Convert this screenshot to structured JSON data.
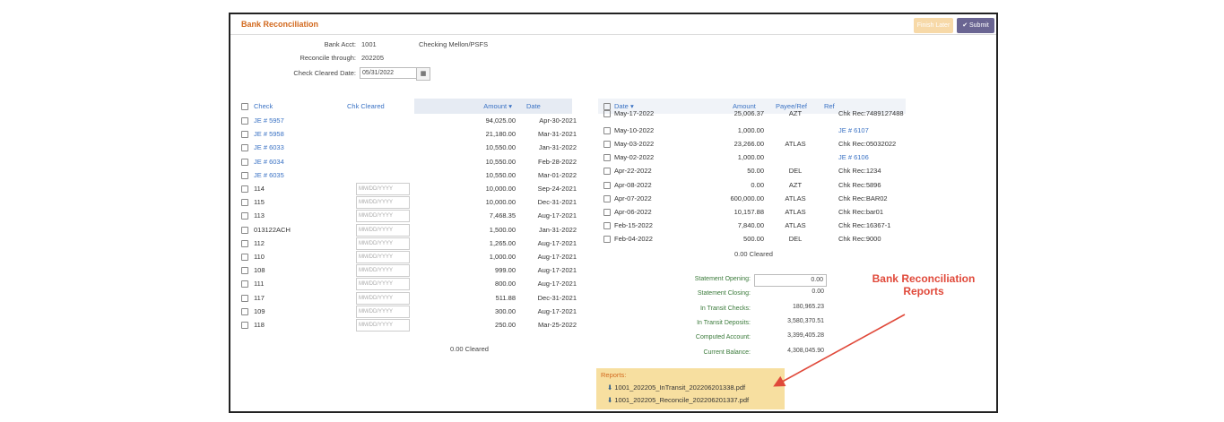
{
  "header": {
    "title": "Bank Reconciliation",
    "finish_later": "Finish Later",
    "submit": "Submit"
  },
  "form": {
    "bank_acct_label": "Bank Acct:",
    "bank_acct_value": "1001",
    "bank_acct_name": "Checking Mellon/PSFS",
    "reconcile_label": "Reconcile through:",
    "reconcile_value": "202205",
    "cleared_label": "Check Cleared Date:",
    "cleared_value": "05/31/2022"
  },
  "left_table": {
    "headers": {
      "check": "Check",
      "chk_cleared": "Chk Cleared",
      "amount": "Amount",
      "date": "Date"
    },
    "placeholder": "MM/DD/YYYY",
    "rows": [
      {
        "check": "JE # 5957",
        "amount": "94,025.00",
        "date": "Apr-30-2021",
        "link": true
      },
      {
        "check": "JE # 5958",
        "amount": "21,180.00",
        "date": "Mar-31-2021",
        "link": true
      },
      {
        "check": "JE # 6033",
        "amount": "10,550.00",
        "date": "Jan-31-2022",
        "link": true
      },
      {
        "check": "JE # 6034",
        "amount": "10,550.00",
        "date": "Feb-28-2022",
        "link": true
      },
      {
        "check": "JE # 6035",
        "amount": "10,550.00",
        "date": "Mar-01-2022",
        "link": true
      },
      {
        "check": "114",
        "amount": "10,000.00",
        "date": "Sep-24-2021",
        "link": false
      },
      {
        "check": "115",
        "amount": "10,000.00",
        "date": "Dec-31-2021",
        "link": false
      },
      {
        "check": "113",
        "amount": "7,468.35",
        "date": "Aug-17-2021",
        "link": false
      },
      {
        "check": "013122ACH",
        "amount": "1,500.00",
        "date": "Jan-31-2022",
        "link": false
      },
      {
        "check": "112",
        "amount": "1,265.00",
        "date": "Aug-17-2021",
        "link": false
      },
      {
        "check": "110",
        "amount": "1,000.00",
        "date": "Aug-17-2021",
        "link": false
      },
      {
        "check": "108",
        "amount": "999.00",
        "date": "Aug-17-2021",
        "link": false
      },
      {
        "check": "111",
        "amount": "800.00",
        "date": "Aug-17-2021",
        "link": false
      },
      {
        "check": "117",
        "amount": "511.88",
        "date": "Dec-31-2021",
        "link": false
      },
      {
        "check": "109",
        "amount": "300.00",
        "date": "Aug-17-2021",
        "link": false
      },
      {
        "check": "118",
        "amount": "250.00",
        "date": "Mar-25-2022",
        "link": false
      }
    ],
    "cleared_text": "0.00 Cleared"
  },
  "right_table": {
    "headers": {
      "date": "Date",
      "amount": "Amount",
      "payee": "Payee/Ref",
      "ref": "Ref"
    },
    "rows": [
      {
        "date": "May-17-2022",
        "amount": "25,006.37",
        "payee": "AZT",
        "ref": "Chk Rec:7489127488",
        "link": false
      },
      {
        "date": "May-10-2022",
        "amount": "1,000.00",
        "payee": "",
        "ref": "JE # 6107",
        "link": true
      },
      {
        "date": "May-03-2022",
        "amount": "23,266.00",
        "payee": "ATLAS",
        "ref": "Chk Rec:05032022",
        "link": false
      },
      {
        "date": "May-02-2022",
        "amount": "1,000.00",
        "payee": "",
        "ref": "JE # 6106",
        "link": true
      },
      {
        "date": "Apr-22-2022",
        "amount": "50.00",
        "payee": "DEL",
        "ref": "Chk Rec:1234",
        "link": false
      },
      {
        "date": "Apr-08-2022",
        "amount": "0.00",
        "payee": "AZT",
        "ref": "Chk Rec:5896",
        "link": false
      },
      {
        "date": "Apr-07-2022",
        "amount": "600,000.00",
        "payee": "ATLAS",
        "ref": "Chk Rec:BAR02",
        "link": false
      },
      {
        "date": "Apr-06-2022",
        "amount": "10,157.88",
        "payee": "ATLAS",
        "ref": "Chk Rec:bar01",
        "link": false
      },
      {
        "date": "Feb-15-2022",
        "amount": "7,840.00",
        "payee": "ATLAS",
        "ref": "Chk Rec:16367-1",
        "link": false
      },
      {
        "date": "Feb-04-2022",
        "amount": "500.00",
        "payee": "DEL",
        "ref": "Chk Rec:9000",
        "link": false
      }
    ],
    "cleared_text": "0.00 Cleared"
  },
  "summary": [
    {
      "label": "Statement Opening:",
      "value": "0.00"
    },
    {
      "label": "Statement Closing:",
      "value": "0.00"
    },
    {
      "label": "In Transit Checks:",
      "value": "180,965.23"
    },
    {
      "label": "In Transit Deposits:",
      "value": "3,580,370.51"
    },
    {
      "label": "Computed Account:",
      "value": "3,399,405.28"
    },
    {
      "label": "Current Balance:",
      "value": "4,308,045.90"
    }
  ],
  "reports": {
    "label": "Reports:",
    "files": [
      "1001_202205_InTransit_202206201338.pdf",
      "1001_202205_Reconcile_202206201337.pdf"
    ]
  },
  "annotation": "Bank Reconciliation Reports",
  "colors": {
    "title": "#d2691e",
    "link": "#3a72c4",
    "submit": "#6a6592",
    "annotation": "#e0493a"
  }
}
